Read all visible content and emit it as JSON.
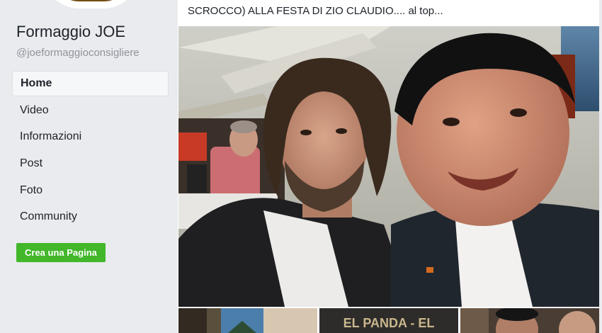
{
  "page": {
    "name": "Formaggio JOE",
    "handle": "@joeformaggioconsigliere"
  },
  "nav": {
    "items": [
      {
        "label": "Home",
        "active": true
      },
      {
        "label": "Video"
      },
      {
        "label": "Informazioni"
      },
      {
        "label": "Post"
      },
      {
        "label": "Foto"
      },
      {
        "label": "Community"
      }
    ]
  },
  "create_page_button": "Crea una Pagina",
  "post": {
    "text": "SCROCCO) ALLA FESTA DI ZIO CLAUDIO.... al top...",
    "thumb_sign_text": "EL PANDA - EL"
  },
  "colors": {
    "accent_green": "#42b72a",
    "sidebar_bg": "#e9ebee",
    "text": "#1d2129",
    "muted": "#90949c"
  }
}
